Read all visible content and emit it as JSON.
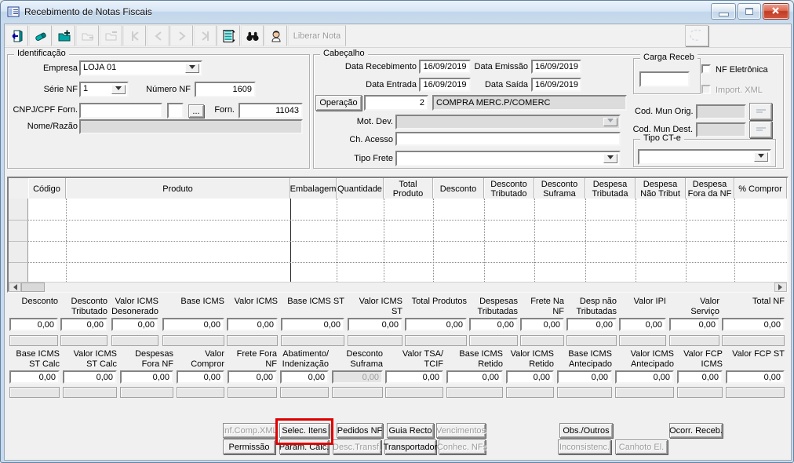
{
  "window": {
    "title": "Recebimento de Notas Fiscais"
  },
  "toolbar": {
    "buttons": [
      {
        "name": "exit",
        "icon": "door-exit-icon",
        "enabled": true
      },
      {
        "name": "erase",
        "icon": "eraser-icon",
        "enabled": true
      },
      {
        "name": "insert",
        "icon": "folder-add-icon",
        "enabled": true
      },
      {
        "name": "post",
        "icon": "folder-confirm-icon",
        "enabled": false
      },
      {
        "name": "cancel",
        "icon": "folder-cancel-icon",
        "enabled": false
      },
      {
        "name": "first-record",
        "icon": "nav-first-icon",
        "enabled": false
      },
      {
        "name": "prior-record",
        "icon": "nav-prior-icon",
        "enabled": false
      },
      {
        "name": "next-record",
        "icon": "nav-next-icon",
        "enabled": false
      },
      {
        "name": "last-record",
        "icon": "nav-last-icon",
        "enabled": false
      },
      {
        "name": "grid-view",
        "icon": "grid-icon",
        "enabled": true
      },
      {
        "name": "search",
        "icon": "binoculars-icon",
        "enabled": true
      },
      {
        "name": "user",
        "icon": "person-icon",
        "enabled": true
      }
    ],
    "liberar_nota_label": "Liberar Nota"
  },
  "identificacao": {
    "title": "Identificação",
    "empresa_label": "Empresa",
    "empresa_value": "LOJA 01",
    "serie_label": "Série NF",
    "serie_value": "1",
    "numero_label": "Número NF",
    "numero_value": "1609",
    "cnpj_label": "CNPJ/CPF Forn.",
    "cnpj_value": "",
    "cnpj_digit_value": "",
    "lookup_button_label": "...",
    "forn_label": "Forn.",
    "forn_value": "11043",
    "nome_label": "Nome/Razão",
    "nome_value": ""
  },
  "cabecalho": {
    "title": "Cabeçalho",
    "data_recebimento_label": "Data Recebimento",
    "data_recebimento": "16/09/2019",
    "data_emissao_label": "Data Emissão",
    "data_emissao": "16/09/2019",
    "data_entrada_label": "Data Entrada",
    "data_entrada": "16/09/2019",
    "data_saida_label": "Data Saída",
    "data_saida": "16/09/2019",
    "operacao_button_label": "Operação",
    "operacao_codigo": "2",
    "operacao_descricao": "COMPRA MERC.P/COMERC",
    "mot_dev_label": "Mot. Dev.",
    "mot_dev_value": "",
    "ch_acesso_label": "Ch. Acesso",
    "ch_acesso_value": "",
    "tipo_frete_label": "Tipo Frete",
    "tipo_frete_value": ""
  },
  "carga": {
    "carga_receb_title": "Carga Receb",
    "carga_receb_value": "",
    "nf_eletronica_label": "NF Eletrônica",
    "nf_eletronica_checked": false,
    "import_xml_label": "Import. XML",
    "import_xml_checked": false,
    "cod_mun_orig_label": "Cod. Mun Orig.",
    "cod_mun_orig_value": "",
    "cod_mun_dest_label": "Cod. Mun Dest.",
    "cod_mun_dest_value": "",
    "tipo_cte_title": "Tipo CT-e",
    "tipo_cte_value": ""
  },
  "grid": {
    "columns": [
      "Código",
      "Produto",
      "Embalagem",
      "Quantidade",
      "Total Produto",
      "Desconto",
      "Desconto Tributado",
      "Desconto Suframa",
      "Despesa Tributada",
      "Despesa Não Tribut",
      "Despesa Fora da NF",
      "% Compror"
    ],
    "rows": []
  },
  "totals": {
    "row1": [
      {
        "label": "Desconto",
        "value": "0,00"
      },
      {
        "label": "Desconto Tributado",
        "value": "0,00"
      },
      {
        "label": "Valor ICMS Desonerado",
        "value": "0,00"
      },
      {
        "label": "Base ICMS",
        "value": "0,00"
      },
      {
        "label": "Valor ICMS",
        "value": "0,00"
      },
      {
        "label": "Base ICMS ST",
        "value": "0,00"
      },
      {
        "label": "Valor ICMS ST",
        "value": "0,00"
      },
      {
        "label": "Total Produtos",
        "value": "0,00"
      },
      {
        "label": "Despesas Tributadas",
        "value": "0,00"
      },
      {
        "label": "Frete Na NF",
        "value": "0,00"
      },
      {
        "label": "Desp não Tributadas",
        "value": "0,00"
      },
      {
        "label": "Valor IPI",
        "value": "0,00"
      },
      {
        "label": "Valor Serviço",
        "value": "0,00"
      },
      {
        "label": "Total NF",
        "value": "0,00"
      }
    ],
    "row2": [
      {
        "label": "Base ICMS ST Calc",
        "value": "0,00"
      },
      {
        "label": "Valor ICMS ST Calc",
        "value": "0,00"
      },
      {
        "label": "Despesas Fora NF",
        "value": "0,00"
      },
      {
        "label": "Valor Compror",
        "value": "0,00"
      },
      {
        "label": "Frete Fora NF",
        "value": "0,00"
      },
      {
        "label": "Abatimento/ Indenização",
        "value": "0,00"
      },
      {
        "label": "Desconto Suframa",
        "value": "0,00",
        "disabled": true
      },
      {
        "label": "Valor TSA/ TCIF",
        "value": "0,00"
      },
      {
        "label": "Base ICMS Retido",
        "value": "0,00"
      },
      {
        "label": "Valor ICMS Retido",
        "value": "0,00"
      },
      {
        "label": "Base ICMS Antecipado",
        "value": "0,00"
      },
      {
        "label": "Valor ICMS Antecipado",
        "value": "0,00"
      },
      {
        "label": "Valor FCP ICMS",
        "value": "0,00"
      },
      {
        "label": "Valor FCP ST",
        "value": "0,00"
      }
    ]
  },
  "footer": {
    "left_row1": [
      {
        "label": "Inf.Comp.XML",
        "enabled": false
      },
      {
        "label": "Selec. Itens",
        "enabled": true,
        "highlighted": true
      },
      {
        "label": "Pedidos NF",
        "enabled": true
      },
      {
        "label": "Guia Recto",
        "enabled": true
      },
      {
        "label": "Vencimentos",
        "enabled": false
      }
    ],
    "left_row2": [
      {
        "label": "Permissão",
        "enabled": true
      },
      {
        "label": "Param. Calc.",
        "enabled": true
      },
      {
        "label": "Desc.Transf.",
        "enabled": false
      },
      {
        "label": "Transportador",
        "enabled": true
      },
      {
        "label": "Conhec. NFs",
        "enabled": false
      }
    ],
    "right_row1": [
      {
        "label": "Obs./Outros",
        "enabled": true
      },
      {
        "label": "Ocorr. Receb.",
        "enabled": true
      }
    ],
    "right_row2": [
      {
        "label": "Inconsistenc.",
        "enabled": false
      },
      {
        "label": "Canhoto El.",
        "enabled": false
      }
    ]
  },
  "annotation": {
    "highlighted_button": "Selec. Itens",
    "color": "#e00000"
  },
  "colors": {
    "titlebar_blue": "#cadced",
    "content_bg": "#f0f0f0",
    "close_button_red": "#c23a22",
    "icon_teal": "#008080",
    "annotation_red": "#e00000"
  }
}
